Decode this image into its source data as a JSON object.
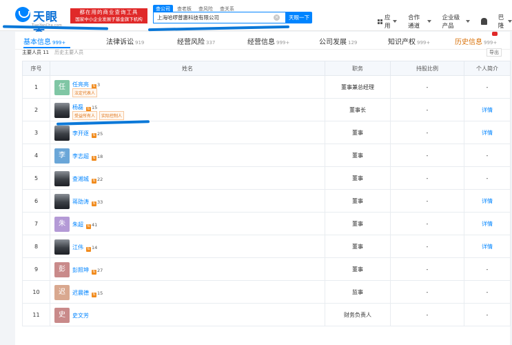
{
  "header": {
    "logo_text": "天眼查",
    "logo_sub": "TianYanCha.com",
    "ad_line1": "都在用的商业查询工具",
    "ad_line2": "国家中小企业发展子基金旗下机构",
    "search_tabs": [
      "查公司",
      "查老板",
      "查风险",
      "查关系"
    ],
    "search_value": "上海哈啰普惠科技有限公司",
    "search_button": "天眼一下",
    "nav": {
      "apps": "应用",
      "partner": "合作通道",
      "enterprise": "企业级产品",
      "user": "巴隆"
    },
    "colors": {
      "brand": "#0084ff",
      "ad": "#e02929"
    }
  },
  "tabs": [
    {
      "label": "基本信息",
      "count": "999+"
    },
    {
      "label": "法律诉讼",
      "count": "919"
    },
    {
      "label": "经营风险",
      "count": "337"
    },
    {
      "label": "经营信息",
      "count": "999+"
    },
    {
      "label": "公司发展",
      "count": "129"
    },
    {
      "label": "知识产权",
      "count": "999+"
    },
    {
      "label": "历史信息",
      "count": "999+"
    }
  ],
  "subrow": {
    "current": "主要人员 11",
    "history": "历史主要人员"
  },
  "export_label": "导出",
  "table": {
    "headers": [
      "序号",
      "姓名",
      "职务",
      "持股比例",
      "个人简介"
    ],
    "rows": [
      {
        "no": "1",
        "name": "任亮亮",
        "links": "3",
        "avatar_char": "任",
        "avatar_color": "#7fc6a4",
        "tags": [
          "法定代表人"
        ],
        "position": "董事兼总经理",
        "share": "-",
        "bio": "-"
      },
      {
        "no": "2",
        "name": "杨磊",
        "links": "15",
        "avatar_char": "",
        "avatar_color": "photo",
        "tags": [
          "受益所有人",
          "实际控制人"
        ],
        "position": "董事长",
        "share": "-",
        "bio": "详情"
      },
      {
        "no": "3",
        "name": "李开逐",
        "links": "25",
        "avatar_char": "",
        "avatar_color": "photo",
        "tags": [],
        "position": "董事",
        "share": "-",
        "bio": "详情"
      },
      {
        "no": "4",
        "name": "李志超",
        "links": "18",
        "avatar_char": "李",
        "avatar_color": "#6aa6d8",
        "tags": [],
        "position": "董事",
        "share": "-",
        "bio": "-"
      },
      {
        "no": "5",
        "name": "查湘城",
        "links": "22",
        "avatar_char": "",
        "avatar_color": "photo",
        "tags": [],
        "position": "董事",
        "share": "-",
        "bio": "-"
      },
      {
        "no": "6",
        "name": "蒋劭涛",
        "links": "33",
        "avatar_char": "",
        "avatar_color": "photo",
        "tags": [],
        "position": "董事",
        "share": "-",
        "bio": "详情"
      },
      {
        "no": "7",
        "name": "朱超",
        "links": "41",
        "avatar_char": "朱",
        "avatar_color": "#b49ad6",
        "tags": [],
        "position": "董事",
        "share": "-",
        "bio": "详情"
      },
      {
        "no": "8",
        "name": "江伟",
        "links": "14",
        "avatar_char": "",
        "avatar_color": "photo",
        "tags": [],
        "position": "董事",
        "share": "-",
        "bio": "详情"
      },
      {
        "no": "9",
        "name": "彭照坤",
        "links": "27",
        "avatar_char": "彭",
        "avatar_color": "#c98a8a",
        "tags": [],
        "position": "董事",
        "share": "-",
        "bio": "-"
      },
      {
        "no": "10",
        "name": "迟晨德",
        "links": "15",
        "avatar_char": "迟",
        "avatar_color": "#d9a88f",
        "tags": [],
        "position": "监事",
        "share": "-",
        "bio": "-"
      },
      {
        "no": "11",
        "name": "史文芳",
        "links": "",
        "avatar_char": "史",
        "avatar_color": "#c98a8a",
        "tags": [],
        "position": "财务负责人",
        "share": "-",
        "bio": "-"
      }
    ]
  }
}
